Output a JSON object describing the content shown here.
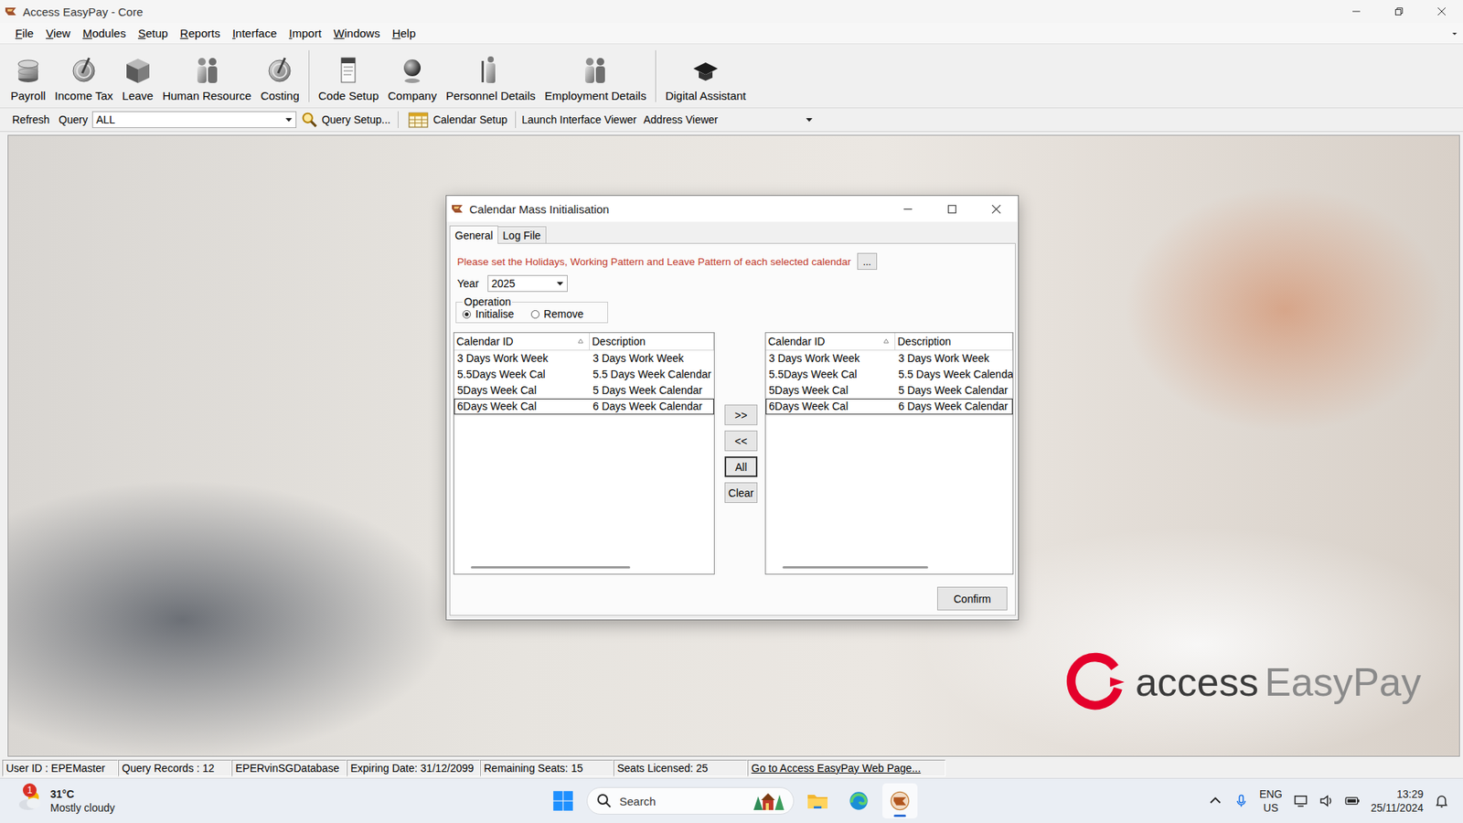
{
  "window": {
    "title": "Access EasyPay - Core"
  },
  "menu": [
    "File",
    "View",
    "Modules",
    "Setup",
    "Reports",
    "Interface",
    "Import",
    "Windows",
    "Help"
  ],
  "toolbar": [
    [
      {
        "label": "Payroll"
      },
      {
        "label": "Income Tax"
      },
      {
        "label": "Leave"
      },
      {
        "label": "Human Resource"
      },
      {
        "label": "Costing"
      }
    ],
    [
      {
        "label": "Code Setup"
      },
      {
        "label": "Company"
      },
      {
        "label": "Personnel Details"
      },
      {
        "label": "Employment Details"
      }
    ],
    [
      {
        "label": "Digital Assistant"
      }
    ]
  ],
  "query_bar": {
    "refresh": "Refresh",
    "query_label": "Query",
    "query_value": "ALL",
    "query_setup": "Query Setup...",
    "calendar_setup": "Calendar Setup",
    "launch_interface_viewer": "Launch Interface Viewer",
    "viewer_value": "Address Viewer"
  },
  "dialog": {
    "title": "Calendar Mass Initialisation",
    "tabs": [
      {
        "label": "General",
        "selected": true
      },
      {
        "label": "Log File",
        "selected": false
      }
    ],
    "instruction": "Please set the Holidays, Working Pattern and Leave Pattern of each selected calendar",
    "more_button": "...",
    "year_label": "Year",
    "year_value": "2025",
    "operation": {
      "label": "Operation",
      "options": [
        {
          "label": "Initialise",
          "selected": true
        },
        {
          "label": "Remove",
          "selected": false
        }
      ]
    },
    "available_list": {
      "columns": [
        {
          "label": "Calendar ID",
          "sorted": true
        },
        {
          "label": "Description",
          "sorted": false
        }
      ],
      "rows": [
        {
          "id": "3 Days Work Week",
          "description": "3 Days Work Week",
          "focused": false
        },
        {
          "id": "5.5Days Week Cal",
          "description": "5.5 Days Week Calendar",
          "focused": false
        },
        {
          "id": "5Days Week Cal",
          "description": "5 Days Week Calendar",
          "focused": false
        },
        {
          "id": "6Days Week Cal",
          "description": "6 Days Week Calendar",
          "focused": true
        }
      ],
      "scroll_level": 0.68
    },
    "selected_list": {
      "columns": [
        {
          "label": "Calendar ID",
          "sorted": true
        },
        {
          "label": "Description",
          "sorted": false
        }
      ],
      "rows": [
        {
          "id": "3 Days Work Week",
          "description": "3 Days Work Week",
          "focused": false
        },
        {
          "id": "5.5Days Week Cal",
          "description": "5.5 Days Week Calenda",
          "focused": false
        },
        {
          "id": "5Days Week Cal",
          "description": "5 Days Week Calendar",
          "focused": false
        },
        {
          "id": "6Days Week Cal",
          "description": "6 Days Week Calendar",
          "focused": true
        }
      ],
      "scroll_level": 0.66
    },
    "transfer_buttons": [
      {
        "label": ">>",
        "focused": false
      },
      {
        "label": "<<",
        "focused": false
      },
      {
        "label": "All",
        "focused": true
      },
      {
        "label": "Clear",
        "focused": false
      }
    ],
    "confirm": "Confirm"
  },
  "logo": {
    "brand": "access",
    "product": "EasyPay"
  },
  "status_bar": [
    {
      "text": "User ID : EPEMaster",
      "kind": "text"
    },
    {
      "text": "Query Records : 12",
      "kind": "text"
    },
    {
      "text": "EPERvinSGDatabase",
      "kind": "text"
    },
    {
      "text": "Expiring Date: 31/12/2099",
      "kind": "text"
    },
    {
      "text": "Remaining Seats: 15",
      "kind": "text"
    },
    {
      "text": "Seats Licensed: 25",
      "kind": "text"
    },
    {
      "text": "Go to Access EasyPay Web Page...",
      "kind": "link"
    }
  ],
  "taskbar": {
    "weather": {
      "temperature": "31°C",
      "condition": "Mostly cloudy",
      "badge": "1"
    },
    "search": {
      "placeholder": "Search"
    },
    "apps": [
      {
        "active": false
      },
      {
        "active": false
      },
      {
        "active": true
      }
    ],
    "tray": {
      "language": "ENG",
      "region": "US",
      "time": "13:29",
      "date": "25/11/2024"
    }
  }
}
